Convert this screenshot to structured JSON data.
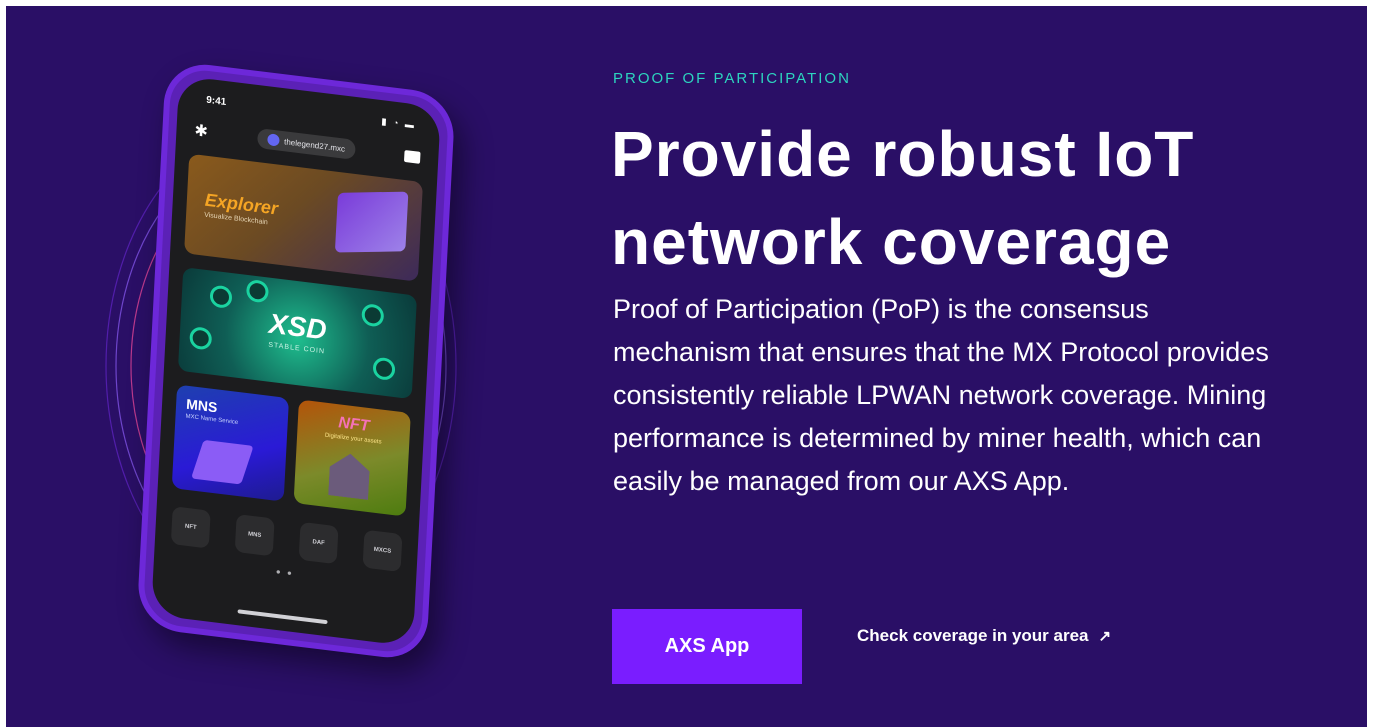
{
  "hero": {
    "eyebrow": "PROOF OF PARTICIPATION",
    "headline_line1": "Provide robust IoT",
    "headline_line2": "network coverage",
    "body": "Proof of Participation (PoP) is the consensus mechanism that ensures that the MX Protocol provides consistently reliable LPWAN network coverage. Mining performance is determined by miner health, which can easily be managed from our AXS App.",
    "primary_button": "AXS App",
    "secondary_link": "Check coverage in your area",
    "secondary_link_icon": "arrow-up-right-icon"
  },
  "phone": {
    "time": "9:41",
    "status_icons": "▮ ◔ ▬",
    "wallet_name": "thelegend27.mxc",
    "cards": {
      "explorer_title": "Explorer",
      "explorer_sub": "Visualize Blockchain",
      "xsd_title": "XSD",
      "xsd_sub": "STABLE COIN",
      "mns_title": "MNS",
      "mns_sub": "MXC Name Service",
      "nft_title": "NFT",
      "nft_sub": "Digitalize your assets"
    },
    "mini_apps": [
      "NFT",
      "MNS",
      "DAF",
      "MXCS"
    ],
    "pager": "● ●"
  },
  "colors": {
    "background": "#2a0f66",
    "accent": "#7a1dff",
    "eyebrow": "#2dd4bf"
  }
}
